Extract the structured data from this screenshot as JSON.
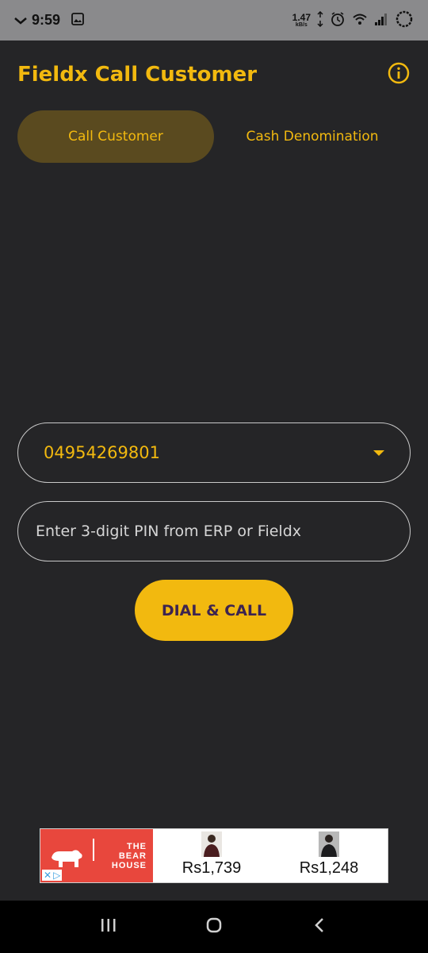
{
  "status_bar": {
    "time": "9:59",
    "net_speed": "1.47",
    "net_speed_unit": "kB/s"
  },
  "header": {
    "title": "Fieldx Call Customer"
  },
  "tabs": [
    {
      "label": "Call Customer",
      "active": true
    },
    {
      "label": "Cash Denomination",
      "active": false
    }
  ],
  "form": {
    "phone_number": "04954269801",
    "pin_placeholder": "Enter 3-digit PIN from ERP or Fieldx",
    "dial_button": "DIAL & CALL"
  },
  "ad": {
    "brand_line1": "THE",
    "brand_line2": "BEAR",
    "brand_line3": "HOUSE",
    "products": [
      {
        "price": "Rs1,739"
      },
      {
        "price": "Rs1,248"
      }
    ]
  },
  "colors": {
    "accent": "#f2b90f",
    "background": "#252527",
    "active_tab": "#5a4a1f",
    "button_text": "#3d2450"
  }
}
